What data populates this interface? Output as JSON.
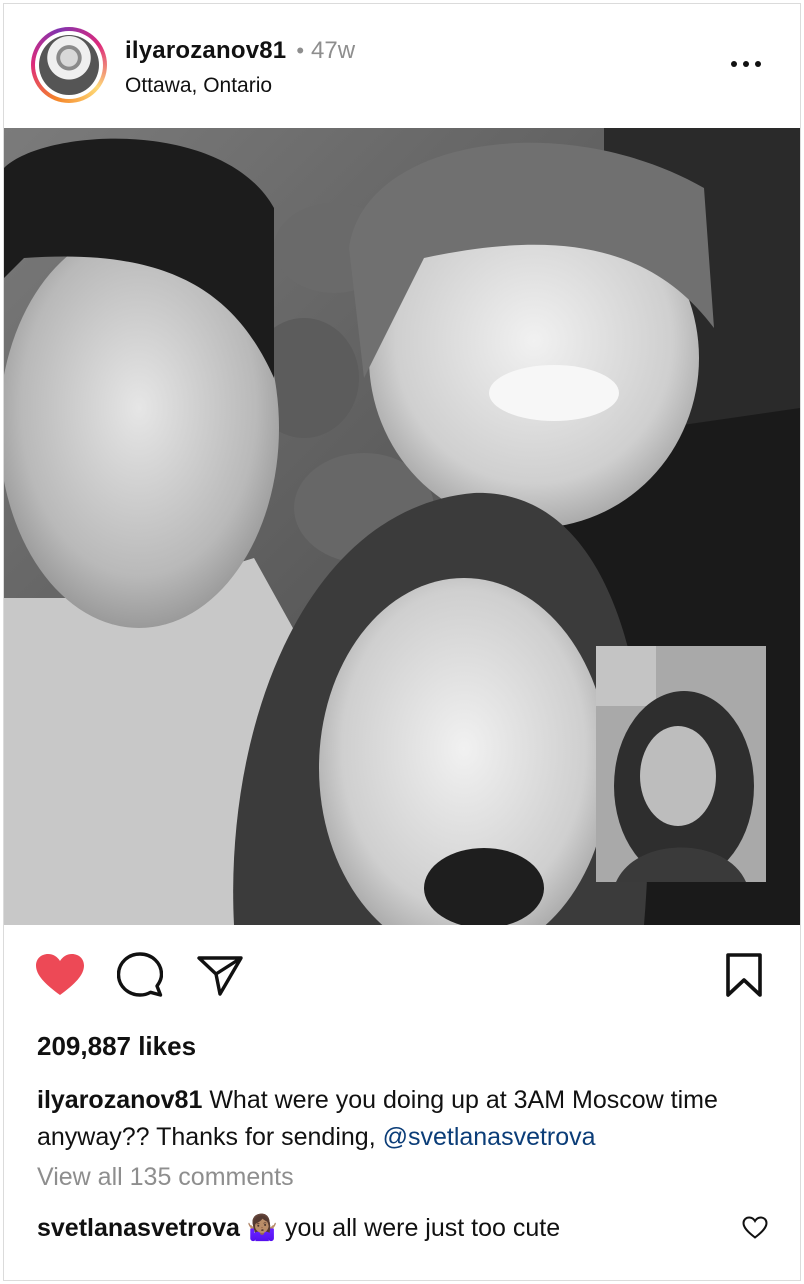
{
  "post": {
    "username": "ilyarozanov81",
    "separator": "•",
    "age": "47w",
    "location": "Ottawa, Ontario"
  },
  "actions": {
    "liked": true,
    "like_color": "#ed4956",
    "icons": [
      "heart-icon",
      "comment-icon",
      "share-icon",
      "bookmark-icon"
    ]
  },
  "likes_text": "209,887 likes",
  "caption": {
    "username": "ilyarozanov81",
    "text": "What were you doing up at 3AM Moscow time anyway?? Thanks for sending,",
    "mention": "@svetlanasvetrova"
  },
  "view_comments": "View all 135 comments",
  "top_comment": {
    "username": "svetlanasvetrova",
    "emoji": "🤷🏽‍♀️",
    "text": "you all were just too cute"
  }
}
